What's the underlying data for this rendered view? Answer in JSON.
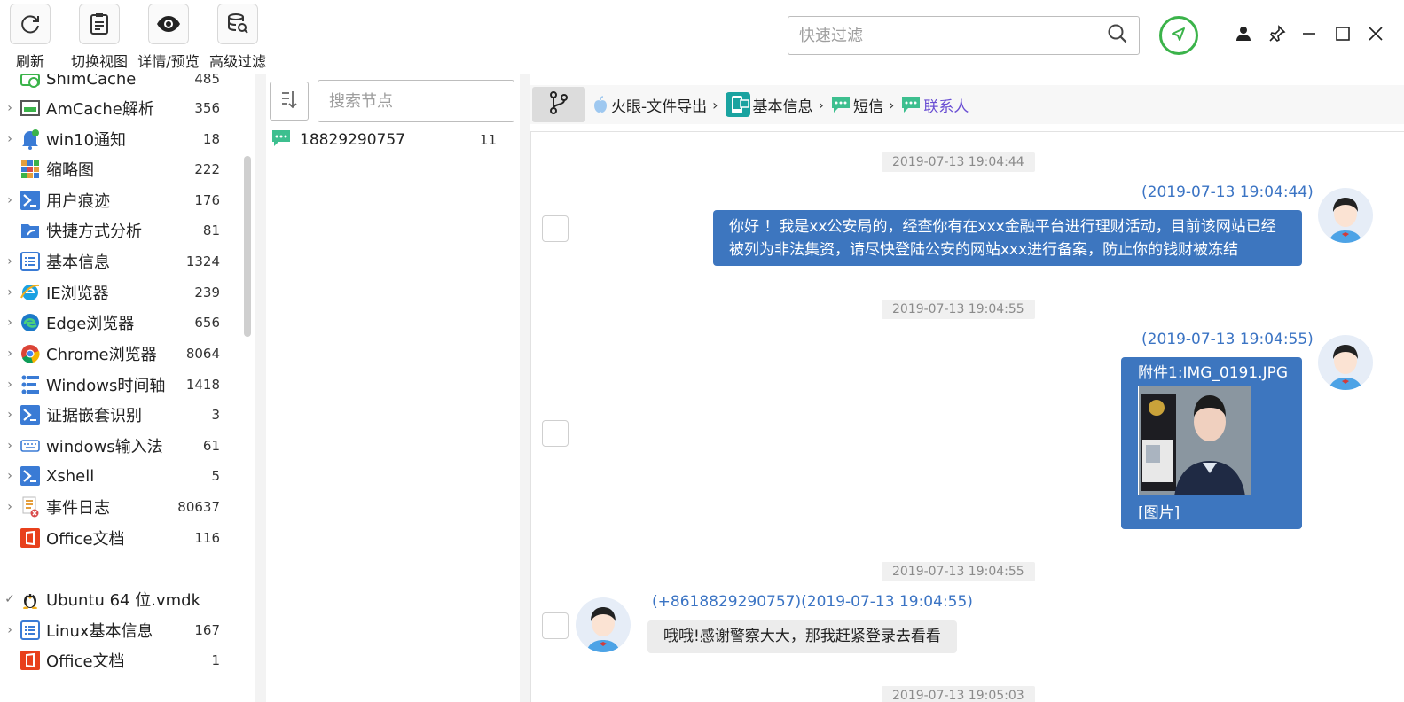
{
  "toolbar": {
    "refresh": "刷新",
    "switch_view": "切换视图",
    "details": "详情/预览",
    "advanced_filter": "高级过滤",
    "filter_placeholder": "快速过滤"
  },
  "tree": {
    "items": [
      {
        "name": "ShimCache",
        "count": "485",
        "icon": "clock-icon"
      },
      {
        "name": "AmCache解析",
        "count": "356",
        "icon": "window-icon"
      },
      {
        "name": "win10通知",
        "count": "18",
        "icon": "bell-icon"
      },
      {
        "name": "缩略图",
        "count": "222",
        "icon": "grid-icon"
      },
      {
        "name": "用户痕迹",
        "count": "176",
        "icon": "terminal-icon"
      },
      {
        "name": "快捷方式分析",
        "count": "81",
        "icon": "folder-icon"
      },
      {
        "name": "基本信息",
        "count": "1324",
        "icon": "list-icon"
      },
      {
        "name": "IE浏览器",
        "count": "239",
        "icon": "ie-icon"
      },
      {
        "name": "Edge浏览器",
        "count": "656",
        "icon": "edge-icon"
      },
      {
        "name": "Chrome浏览器",
        "count": "8064",
        "icon": "chrome-icon"
      },
      {
        "name": "Windows时间轴",
        "count": "1418",
        "icon": "timeline-icon"
      },
      {
        "name": "证据嵌套识别",
        "count": "3",
        "icon": "terminal-icon"
      },
      {
        "name": "windows输入法",
        "count": "61",
        "icon": "keyboard-icon"
      },
      {
        "name": "Xshell",
        "count": "5",
        "icon": "terminal-icon"
      },
      {
        "name": "事件日志",
        "count": "80637",
        "icon": "log-icon"
      },
      {
        "name": "Office文档",
        "count": "116",
        "icon": "office-icon"
      }
    ],
    "ubuntu": {
      "name": "Ubuntu 64 位.vmdk"
    },
    "ubuntu_items": [
      {
        "name": "Linux基本信息",
        "count": "167",
        "icon": "list-icon"
      },
      {
        "name": "Office文档",
        "count": "1",
        "icon": "office-icon"
      }
    ]
  },
  "nodes": {
    "search_placeholder": "搜索节点",
    "items": [
      {
        "name": "18829290757",
        "count": "11"
      }
    ]
  },
  "breadcrumb": {
    "items": [
      "火眼-文件导出",
      "基本信息",
      "短信",
      "联系人"
    ]
  },
  "chat": {
    "ts1": "2019-07-13 19:04:44",
    "m1_time": "(2019-07-13 19:04:44)",
    "m1_text": "你好 ！我是xx公安局的，经查你有在xxx金融平台进行理财活动，目前该网站已经被列为非法集资，请尽快登陆公安的网站xxx进行备案，防止你的钱财被冻结",
    "ts2": "2019-07-13 19:04:55",
    "m2_time": "(2019-07-13 19:04:55)",
    "m2_attach": "附件1:IMG_0191.JPG",
    "m2_caption": "[图片]",
    "ts3": "2019-07-13 19:04:55",
    "m3_meta": "(+8618829290757)(2019-07-13 19:04:55)",
    "m3_text": "哦哦!感谢警察大大，那我赶紧登录去看看",
    "ts4": "2019-07-13 19:05:03"
  },
  "colors": {
    "accent": "#3d76bf",
    "green": "#3bb34a",
    "link": "#6a4fd3"
  }
}
